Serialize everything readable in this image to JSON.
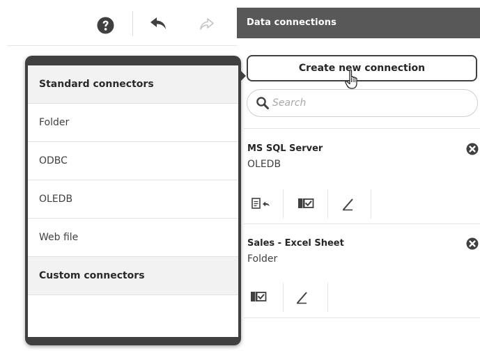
{
  "toolbar": {
    "help_icon": "question-circle-icon",
    "undo_icon": "undo-arrow-icon",
    "redo_icon": "redo-arrow-icon",
    "redo_enabled": false
  },
  "panel": {
    "title": "Data connections",
    "create_button_label": "Create new connection",
    "search_placeholder": "Search",
    "connections": [
      {
        "name": "MS SQL Server",
        "type": "OLEDB",
        "actions": [
          "insert-script-icon",
          "select-data-icon",
          "edit-pencil-icon"
        ]
      },
      {
        "name": "Sales - Excel Sheet",
        "type": "Folder",
        "actions": [
          "select-data-icon",
          "edit-pencil-icon"
        ]
      }
    ]
  },
  "popover": {
    "standard_header": "Standard connectors",
    "items": [
      "Folder",
      "ODBC",
      "OLEDB",
      "Web file"
    ],
    "custom_header": "Custom connectors"
  },
  "colors": {
    "header_bg": "#585858",
    "popover_frame": "#404040",
    "group_bg": "#f2f2f2",
    "text": "#404040"
  }
}
